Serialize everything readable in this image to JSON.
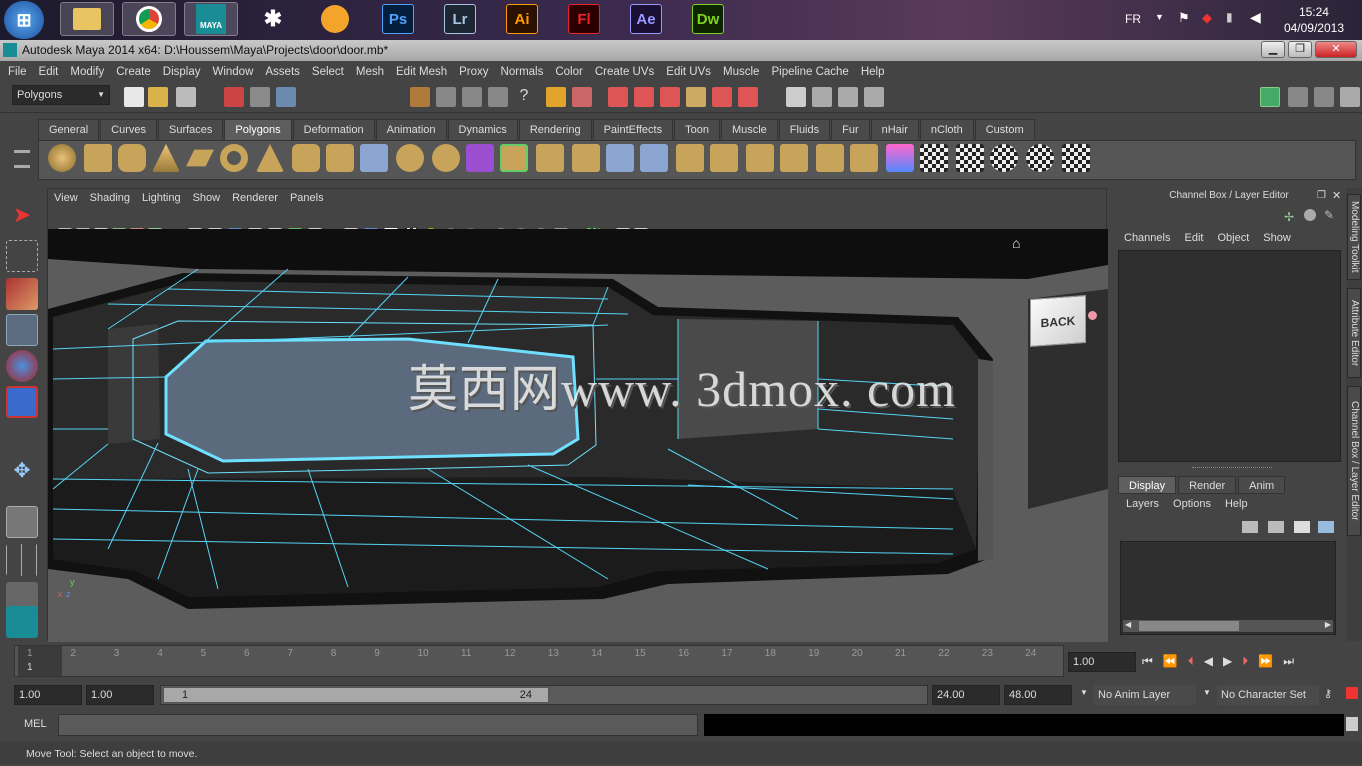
{
  "taskbar": {
    "apps": [
      {
        "name": "windows-start",
        "label": "",
        "color": "#2d7cd6"
      },
      {
        "name": "explorer",
        "label": "",
        "color": "#e8c561"
      },
      {
        "name": "chrome",
        "label": "",
        "color": "#3c9a4a"
      },
      {
        "name": "maya",
        "label": "MAYA",
        "color": "#1a8c96"
      },
      {
        "name": "zbrush",
        "label": "",
        "color": "#dddddd"
      },
      {
        "name": "nuke",
        "label": "",
        "color": "#f2a52a"
      },
      {
        "name": "photoshop",
        "label": "Ps",
        "color": "#4fa3ff"
      },
      {
        "name": "lightroom",
        "label": "Lr",
        "color": "#a8c4e0"
      },
      {
        "name": "illustrator",
        "label": "Ai",
        "color": "#ff9a00"
      },
      {
        "name": "flash",
        "label": "Fl",
        "color": "#e8252b"
      },
      {
        "name": "after-effects",
        "label": "Ae",
        "color": "#9999ff"
      },
      {
        "name": "dreamweaver",
        "label": "Dw",
        "color": "#7ed321"
      }
    ],
    "language": "FR",
    "time": "15:24",
    "date": "04/09/2013"
  },
  "window": {
    "title": "Autodesk Maya 2014 x64: D:\\Houssem\\Maya\\Projects\\door\\door.mb*"
  },
  "menubar": [
    "File",
    "Edit",
    "Modify",
    "Create",
    "Display",
    "Window",
    "Assets",
    "Select",
    "Mesh",
    "Edit Mesh",
    "Proxy",
    "Normals",
    "Color",
    "Create UVs",
    "Edit UVs",
    "Muscle",
    "Pipeline Cache",
    "Help"
  ],
  "statusline": {
    "menuset": "Polygons"
  },
  "shelf": {
    "tabs": [
      "General",
      "Curves",
      "Surfaces",
      "Polygons",
      "Deformation",
      "Animation",
      "Dynamics",
      "Rendering",
      "PaintEffects",
      "Toon",
      "Muscle",
      "Fluids",
      "Fur",
      "nHair",
      "nCloth",
      "Custom"
    ],
    "active_tab": "Polygons"
  },
  "viewport": {
    "menu": [
      "View",
      "Shading",
      "Lighting",
      "Show",
      "Renderer",
      "Panels"
    ],
    "watermark": "莫西网www. 3dmox. com",
    "viewcube_label": "BACK",
    "axis_x": "x",
    "axis_y": "y",
    "axis_z": "z"
  },
  "channelbox": {
    "title": "Channel Box / Layer Editor",
    "menu": [
      "Channels",
      "Edit",
      "Object",
      "Show"
    ],
    "layer_tabs": [
      "Display",
      "Render",
      "Anim"
    ],
    "active_layer_tab": "Display",
    "layer_menu": [
      "Layers",
      "Options",
      "Help"
    ]
  },
  "side_tabs": [
    "Modeling Toolkit",
    "Attribute Editor",
    "Channel Box / Layer Editor"
  ],
  "timeslider": {
    "ticks": [
      "1",
      "2",
      "3",
      "4",
      "5",
      "6",
      "7",
      "8",
      "9",
      "10",
      "11",
      "12",
      "13",
      "14",
      "15",
      "16",
      "17",
      "18",
      "19",
      "20",
      "21",
      "22",
      "23",
      "24"
    ],
    "current_frame": "1",
    "current_time_field": "1.00"
  },
  "range": {
    "start_time": "1.00",
    "playback_start": "1.00",
    "range_start": "1",
    "range_end": "24",
    "playback_end": "24.00",
    "end_time": "48.00",
    "anim_layer": "No Anim Layer",
    "character_set": "No Character Set"
  },
  "cmdline": {
    "label": "MEL"
  },
  "helpline": {
    "text": "Move Tool: Select an object to move."
  },
  "colors": {
    "wire": "#66d9ff",
    "selected": "#4fc3f7",
    "ui_bg": "#444444",
    "viewport_bg": "#5a5a5a"
  }
}
